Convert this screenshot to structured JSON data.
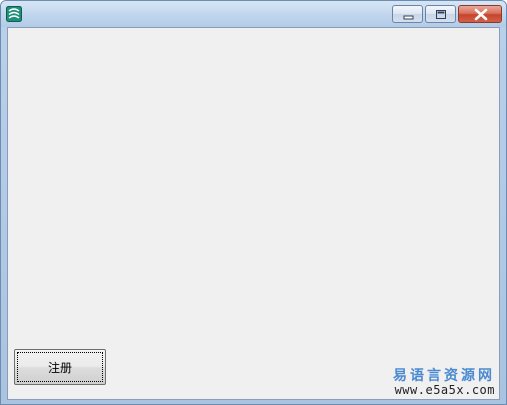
{
  "window": {
    "title": "",
    "caption_buttons": {
      "minimize": "minimize-icon",
      "maximize": "maximize-icon",
      "close": "close-icon"
    }
  },
  "form": {
    "register_button_label": "注册"
  },
  "watermark": {
    "name": "易语言资源网",
    "url": "www.e5a5x.com"
  },
  "colors": {
    "title_bar": "#c2d7ee",
    "client_bg": "#f0f0f0",
    "close_button": "#c7452c",
    "watermark_text": "#4a8ad0"
  }
}
